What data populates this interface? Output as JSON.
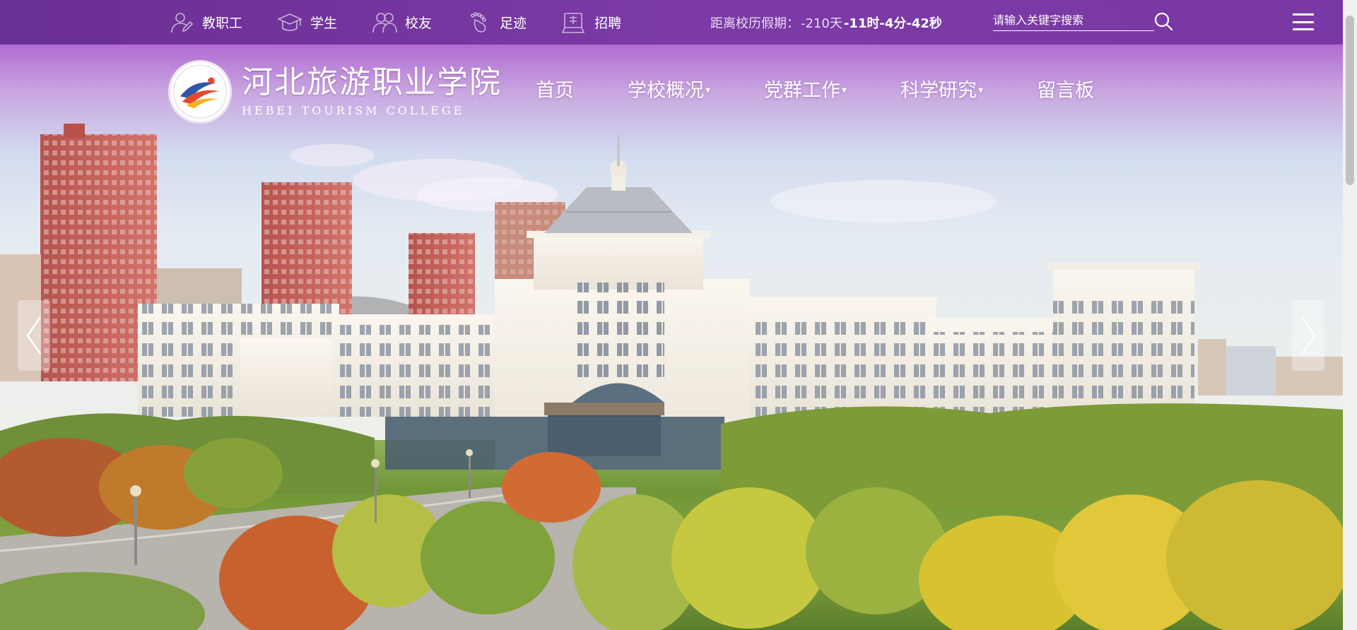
{
  "topbar": {
    "quick_links": [
      {
        "label": "教职工",
        "icon": "staff-icon"
      },
      {
        "label": "学生",
        "icon": "graduation-cap-icon"
      },
      {
        "label": "校友",
        "icon": "alumni-icon"
      },
      {
        "label": "足迹",
        "icon": "footprint-icon"
      },
      {
        "label": "招聘",
        "icon": "recruitment-icon"
      }
    ],
    "countdown": {
      "prefix": "距离校历假期：",
      "days": "-210天",
      "hours": "-11时",
      "minutes": "-4分",
      "seconds": "-42秒"
    },
    "search": {
      "placeholder": "请输入关键字搜索",
      "value": ""
    },
    "menu_icon": "hamburger-menu-icon"
  },
  "brand": {
    "name": "河北旅游职业学院",
    "name_en": "HEBEI TOURISM COLLEGE",
    "emblem_text": "河北旅游职业学院"
  },
  "main_nav": {
    "items": [
      {
        "label": "首页",
        "has_dropdown": false
      },
      {
        "label": "学校概况",
        "has_dropdown": true
      },
      {
        "label": "党群工作",
        "has_dropdown": true
      },
      {
        "label": "科学研究",
        "has_dropdown": true
      },
      {
        "label": "留言板",
        "has_dropdown": false
      }
    ],
    "dropdown_glyph": "▾"
  },
  "carousel": {
    "prev_icon": "chevron-left-icon",
    "next_icon": "chevron-right-icon"
  },
  "colors": {
    "topbar": "#72329c",
    "accent": "#8e47b8",
    "text_on_dark": "#ffffff"
  }
}
